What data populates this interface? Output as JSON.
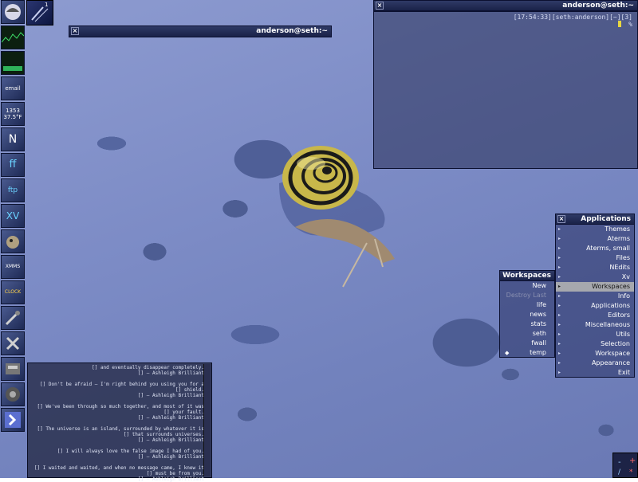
{
  "terminal": {
    "title": "anderson@seth:~",
    "status_line": "[17:54:33][seth:anderson][~][3]",
    "prompt": "%"
  },
  "shaded_window": {
    "title": "anderson@seth:~"
  },
  "applications_menu": {
    "title": "Applications",
    "items": [
      {
        "label": "Themes",
        "submenu": true
      },
      {
        "label": "Aterms",
        "submenu": true
      },
      {
        "label": "Aterms, small",
        "submenu": true
      },
      {
        "label": "Files",
        "submenu": true
      },
      {
        "label": "NEdits",
        "submenu": true
      },
      {
        "label": "Xv",
        "submenu": true
      },
      {
        "label": "Workspaces",
        "submenu": true,
        "selected": true
      },
      {
        "label": "Info",
        "submenu": true
      },
      {
        "label": "Applications",
        "submenu": true
      },
      {
        "label": "Editors",
        "submenu": true
      },
      {
        "label": "Miscellaneous",
        "submenu": true
      },
      {
        "label": "Utils",
        "submenu": true
      },
      {
        "label": "Selection",
        "submenu": true
      },
      {
        "label": "Workspace",
        "submenu": true
      },
      {
        "label": "Appearance",
        "submenu": true
      },
      {
        "label": "Exit",
        "submenu": true
      }
    ]
  },
  "workspaces_menu": {
    "title": "Workspaces",
    "items": [
      {
        "label": "New",
        "dim": false,
        "mark": ""
      },
      {
        "label": "Destroy Last",
        "dim": true,
        "mark": ""
      },
      {
        "label": "life",
        "dim": false,
        "mark": ""
      },
      {
        "label": "news",
        "dim": false,
        "mark": ""
      },
      {
        "label": "stats",
        "dim": false,
        "mark": ""
      },
      {
        "label": "seth",
        "dim": false,
        "mark": ""
      },
      {
        "label": "fwall",
        "dim": false,
        "mark": ""
      },
      {
        "label": "temp",
        "dim": false,
        "mark": "◆"
      }
    ]
  },
  "fortune": {
    "text": "[] and eventually disappear completely.\n[] — Ashleigh Brilliant\n\n[] Don't be afraid — I'm right behind you using you for a\n[] shield.\n[] — Ashleigh Brilliant\n\n[] We've been through so much together, and most of it was\n[] your fault.\n[] — Ashleigh Brilliant\n\n[] The universe is an island, surrounded by whatever it is\n[] that surrounds universes.\n[] — Ashleigh Brilliant\n\n[] I will always love the false image I had of you.\n[] — Ashleigh Brilliant\n\n[] I waited and waited, and when no message came, I knew it\n[] must be from you.\n[] — Ashleigh Brilliant"
  },
  "dock": {
    "tiles": [
      {
        "name": "wmaker-logo-tile",
        "label": ""
      },
      {
        "name": "cpu-monitor-tile",
        "label": ""
      },
      {
        "name": "memory-monitor-tile",
        "label": ""
      },
      {
        "name": "mail-tile",
        "label": "email"
      },
      {
        "name": "weather-tile",
        "label": "1353\n37.5°F"
      },
      {
        "name": "nedit-tile",
        "label": "N"
      },
      {
        "name": "font-tile",
        "label": "ff"
      },
      {
        "name": "ftp-tile",
        "label": "ftp"
      },
      {
        "name": "xv-tile",
        "label": "XV"
      },
      {
        "name": "gimp-tile",
        "label": ""
      },
      {
        "name": "xmms-tile",
        "label": "XMMS"
      },
      {
        "name": "clock-tile",
        "label": "CLOCK"
      },
      {
        "name": "tools-tile",
        "label": ""
      },
      {
        "name": "settings-tile",
        "label": ""
      },
      {
        "name": "disk-tile",
        "label": ""
      },
      {
        "name": "audio-tile",
        "label": ""
      },
      {
        "name": "kde-tile",
        "label": ""
      }
    ]
  },
  "clip": {
    "label": "1"
  }
}
